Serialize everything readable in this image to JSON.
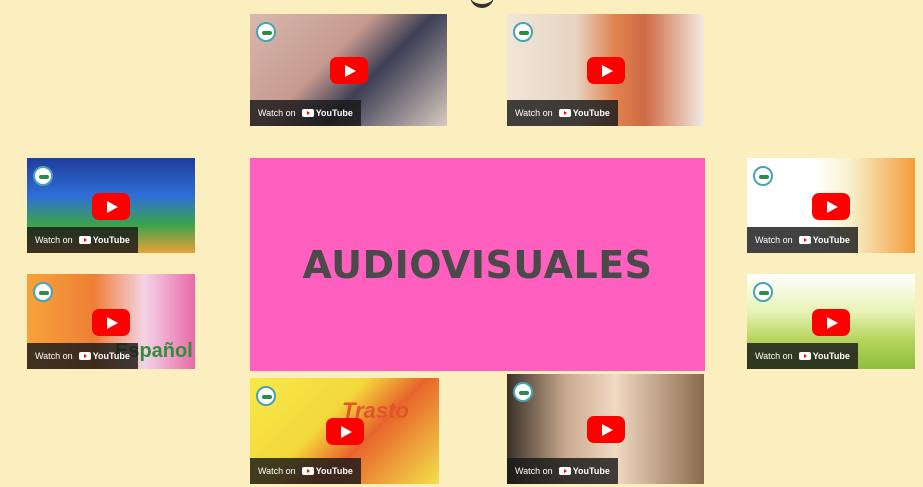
{
  "center": {
    "title": "AUDIOVISUALES"
  },
  "watch_label": "Watch on",
  "youtube_label": "YouTube",
  "videos": [
    {
      "id": "top-left",
      "bg": "linear-gradient(135deg,#d7b8ae 0%,#c79a8f 40%,#3d3f55 60%,#d9c9c0 100%)"
    },
    {
      "id": "top-right",
      "bg": "linear-gradient(90deg,#f1e6d8 0%,#e7d4c1 35%,#e0834f 55%,#cf6a45 70%,#f2ebe2 100%)"
    },
    {
      "id": "mid-left",
      "bg": "linear-gradient(180deg,#1f3d9c 0%,#2f6ed8 40%,#3aa34c 70%,#e8a13a 100%)"
    },
    {
      "id": "bottom-left-1",
      "bg": "linear-gradient(90deg,#f6a33a 0%,#ef7f36 40%,#f4d3e6 70%,#e96aa8 100%)",
      "overlay_text": "Español",
      "overlay_color": "#2e8f3a"
    },
    {
      "id": "mid-right",
      "bg": "linear-gradient(90deg,#ffffff 0%,#ffffff 40%,#f8f3d0 60%,#f39c3a 100%)"
    },
    {
      "id": "bottom-right",
      "bg": "linear-gradient(180deg,#ffffff 0%,#e8f3b5 40%,#b5d35a 70%,#8cbf3e 100%)"
    },
    {
      "id": "bottom-left-2",
      "bg": "linear-gradient(135deg,#f7e94a 0%,#f4d83a 40%,#e8642c 60%,#f3e04a 100%)",
      "overlay_text": "Trasto",
      "overlay_color": "#e0562a"
    },
    {
      "id": "bottom-center",
      "bg": "linear-gradient(90deg,#3a3028 0%,#c9a98e 30%,#f1d9c4 55%,#8a6a4c 100%)"
    }
  ]
}
